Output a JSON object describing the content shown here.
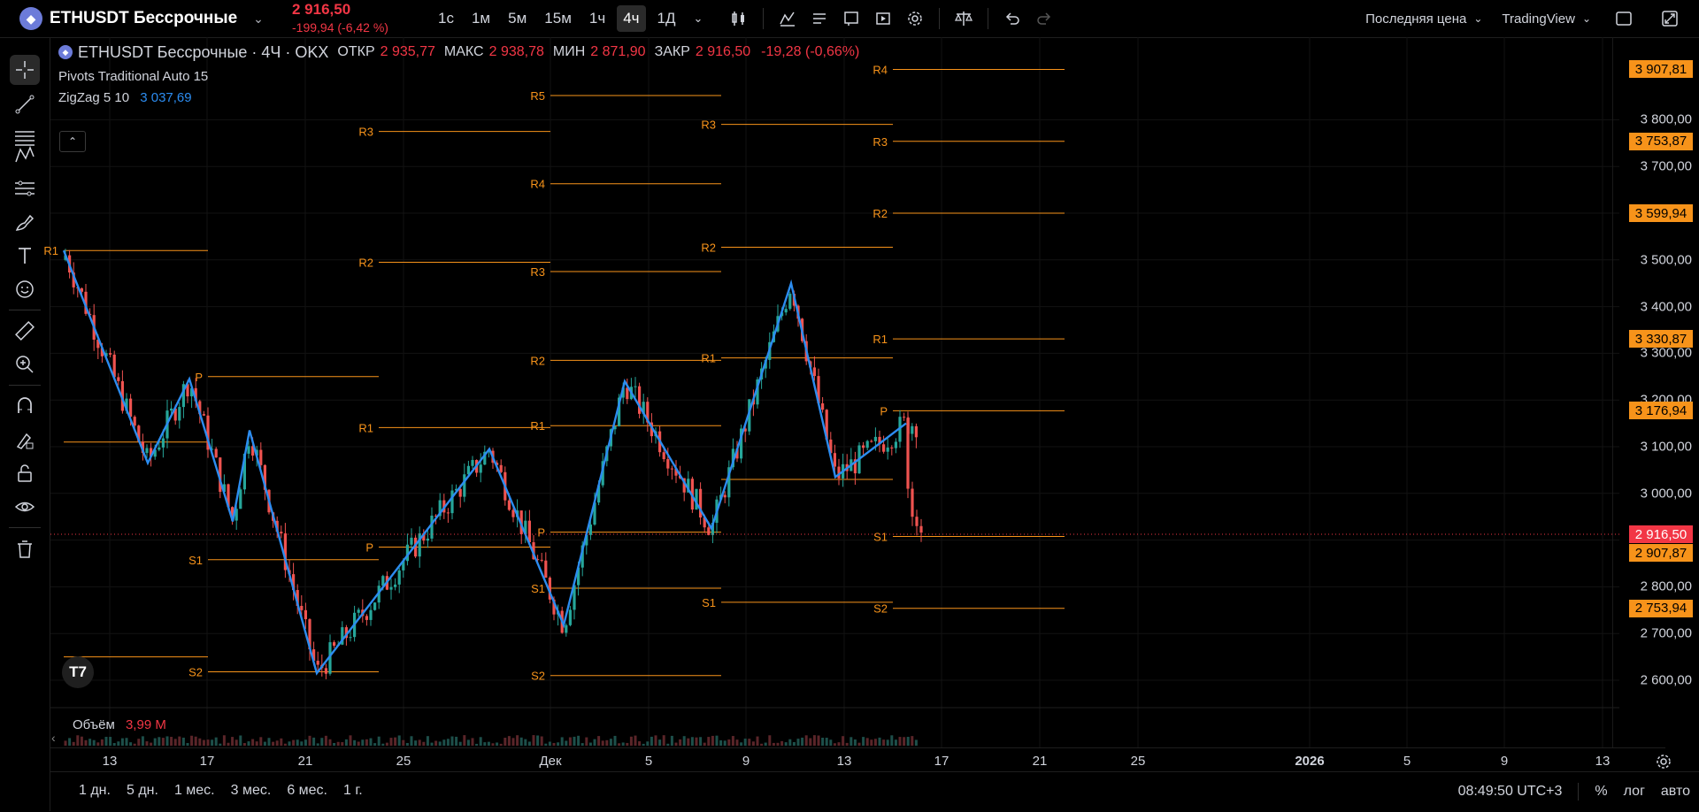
{
  "symbol": {
    "name": "ETHUSDT Бессрочные",
    "price": "2 916,50",
    "change": "-199,94 (-6,42 %)"
  },
  "intervals": [
    {
      "label": "1с",
      "active": false
    },
    {
      "label": "1м",
      "active": false
    },
    {
      "label": "5м",
      "active": false
    },
    {
      "label": "15м",
      "active": false
    },
    {
      "label": "1ч",
      "active": false
    },
    {
      "label": "4ч",
      "active": true
    },
    {
      "label": "1Д",
      "active": false
    }
  ],
  "topbar_right": {
    "price_source": "Последняя цена",
    "chart_provider": "TradingView"
  },
  "legend": {
    "title": "ETHUSDT Бессрочные · 4Ч · OKX",
    "open_label": "ОТКР",
    "open": "2 935,77",
    "high_label": "МАКС",
    "high": "2 938,78",
    "low_label": "МИН",
    "low": "2 871,90",
    "close_label": "ЗАКР",
    "close": "2 916,50",
    "change": "-19,28 (-0,66%)",
    "indicator1": "Pivots Traditional Auto 15",
    "indicator2_name": "ZigZag 5 10",
    "indicator2_value": "3 037,69"
  },
  "volume": {
    "label": "Объём",
    "value": "3,99 M"
  },
  "logo_text": "T7",
  "x_axis": [
    "13",
    "17",
    "21",
    "25",
    "Дек",
    "5",
    "9",
    "13",
    "17",
    "21",
    "25",
    "2026",
    "5",
    "9",
    "13"
  ],
  "y_axis": [
    "3 800,00",
    "3 700,00",
    "3 500,00",
    "3 400,00",
    "3 300,00",
    "3 200,00",
    "3 100,00",
    "3 000,00",
    "2 800,00",
    "2 700,00",
    "2 600,00"
  ],
  "price_badges": [
    {
      "label": "3 907,81",
      "color": "#f7931a"
    },
    {
      "label": "3 753,87",
      "color": "#f7931a"
    },
    {
      "label": "3 599,94",
      "color": "#f7931a"
    },
    {
      "label": "3 330,87",
      "color": "#f7931a"
    },
    {
      "label": "3 176,94",
      "color": "#f7931a"
    },
    {
      "label": "2 916,50",
      "color": "#f23645"
    },
    {
      "label": "2 907,87",
      "color": "#f7931a"
    },
    {
      "label": "2 753,94",
      "color": "#f7931a"
    }
  ],
  "pivot_labels": [
    "R1",
    "P",
    "S1",
    "S2",
    "R2",
    "R1",
    "P",
    "R3",
    "R5",
    "R4",
    "R3",
    "R2",
    "R1",
    "P",
    "S1",
    "S2",
    "R3",
    "R2",
    "R1",
    "S1",
    "R4",
    "R3",
    "R2",
    "R1",
    "P",
    "S1",
    "S2"
  ],
  "ranges": [
    "1 дн.",
    "5 дн.",
    "1 мес.",
    "3 мес.",
    "6 мес.",
    "1 г."
  ],
  "bottom_right": {
    "time": "08:49:50 UTC+3",
    "percent": "%",
    "log": "лог",
    "auto": "авто"
  },
  "colors": {
    "up": "#26a69a",
    "down": "#ef5350",
    "zigzag": "#2c8cf0",
    "pivot": "#f7931a",
    "background": "#000000"
  },
  "left_toolbar_icons": [
    "crosshair-icon",
    "trend-line-icon",
    "fib-icon",
    "pattern-icon",
    "prediction-icon",
    "brush-icon",
    "text-icon",
    "emoji-icon",
    "ruler-icon",
    "zoom-icon",
    "magnet-icon",
    "lock-drawing-icon",
    "lock-icon",
    "eye-icon",
    "trash-icon"
  ]
}
